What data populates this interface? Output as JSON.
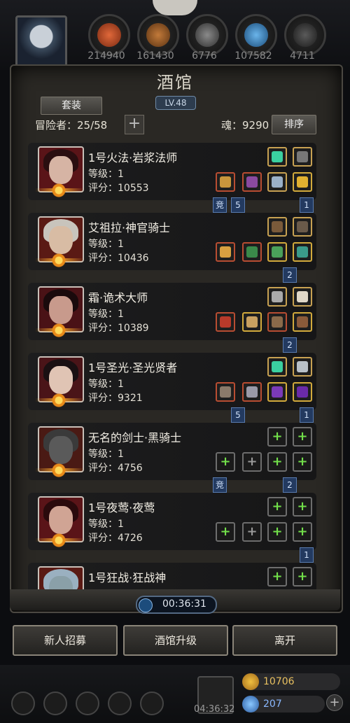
{
  "resources": [
    {
      "name": "flame-resource",
      "value": "214940"
    },
    {
      "name": "wood-resource",
      "value": "161430"
    },
    {
      "name": "iron-resource",
      "value": "6776"
    },
    {
      "name": "crystal-resource",
      "value": "107582"
    },
    {
      "name": "stone-resource",
      "value": "4711"
    }
  ],
  "panel": {
    "title": "酒馆",
    "level": "LV.48",
    "set_button": "套装",
    "adventurers_label": "冒险者：25/58",
    "soul_label": "魂：9290",
    "sort_button": "排序"
  },
  "heroes": [
    {
      "name": "1号火法·岩浆法师",
      "level": "等级：1",
      "score": "评分：10553"
    },
    {
      "name": "艾祖拉·神官骑士",
      "level": "等级：1",
      "score": "评分：10436"
    },
    {
      "name": "霜·诡术大师",
      "level": "等级：1",
      "score": "评分：10389"
    },
    {
      "name": "1号圣光·圣光贤者",
      "level": "等级：1",
      "score": "评分：9321"
    },
    {
      "name": "无名的剑士·黑骑士",
      "level": "等级：1",
      "score": "评分：4756"
    },
    {
      "name": "1号夜莺·夜莺",
      "level": "等级：1",
      "score": "评分：4726"
    },
    {
      "name": "1号狂战·狂战神",
      "level": "",
      "score": ""
    }
  ],
  "tags": {
    "compete": "竞",
    "five": "5",
    "one": "1",
    "two": "2"
  },
  "timer": "00:36:31",
  "buttons": {
    "recruit": "新人招募",
    "upgrade": "酒馆升级",
    "leave": "离开"
  },
  "bottom": {
    "chest_timer": "04:36:32",
    "gold": "10706",
    "gems": "207"
  },
  "colors": {
    "accent_plus": "#72e04a",
    "tag_blue": "#233a60",
    "gold_frame": "#c7a152"
  }
}
